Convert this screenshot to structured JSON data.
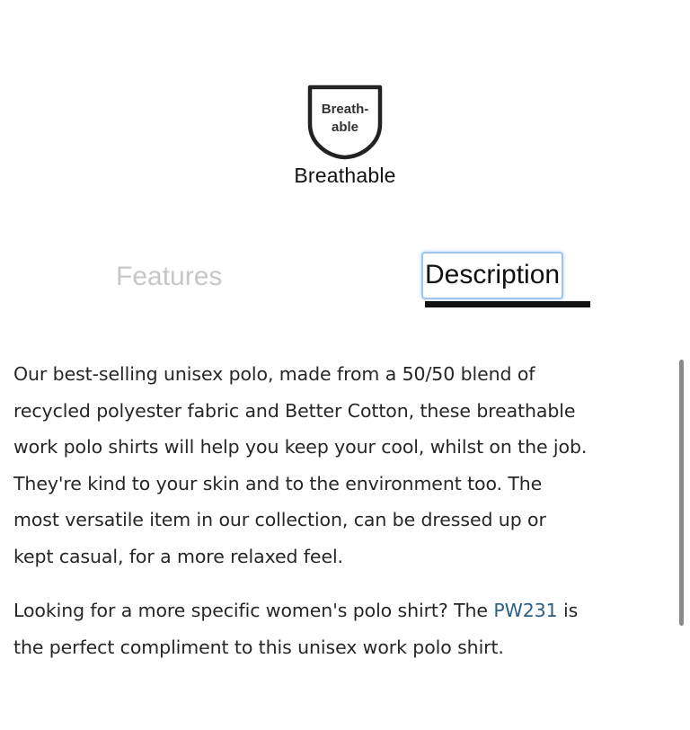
{
  "badge": {
    "icon_name": "breathable-shield-icon",
    "icon_text_line1": "Breath-",
    "icon_text_line2": "able",
    "caption": "Breathable"
  },
  "tabs": {
    "features_label": "Features",
    "description_label": "Description",
    "active": "Description"
  },
  "description": {
    "para1_lines": [
      "Our best-selling unisex polo, made from a 50/50 blend of",
      "recycled polyester fabric and Better Cotton, these breathable",
      "work polo shirts will help you keep your cool, whilst on the job.",
      "They're  kind to your skin and to the environment too. The",
      "most versatile item in our collection, can be dressed up or",
      "kept casual, for a more relaxed feel."
    ],
    "para2_line1_before": "Looking for a more specific women's polo shirt?  The ",
    "para2_link": "PW231",
    "para2_line1_after": " is",
    "para2_line2": "the perfect compliment to this unisex work polo shirt."
  },
  "colors": {
    "link": "#2b5f86",
    "inactive_tab": "#c7c7c7",
    "active_tab": "#111111",
    "focus_ring": "#9ec5f0"
  }
}
